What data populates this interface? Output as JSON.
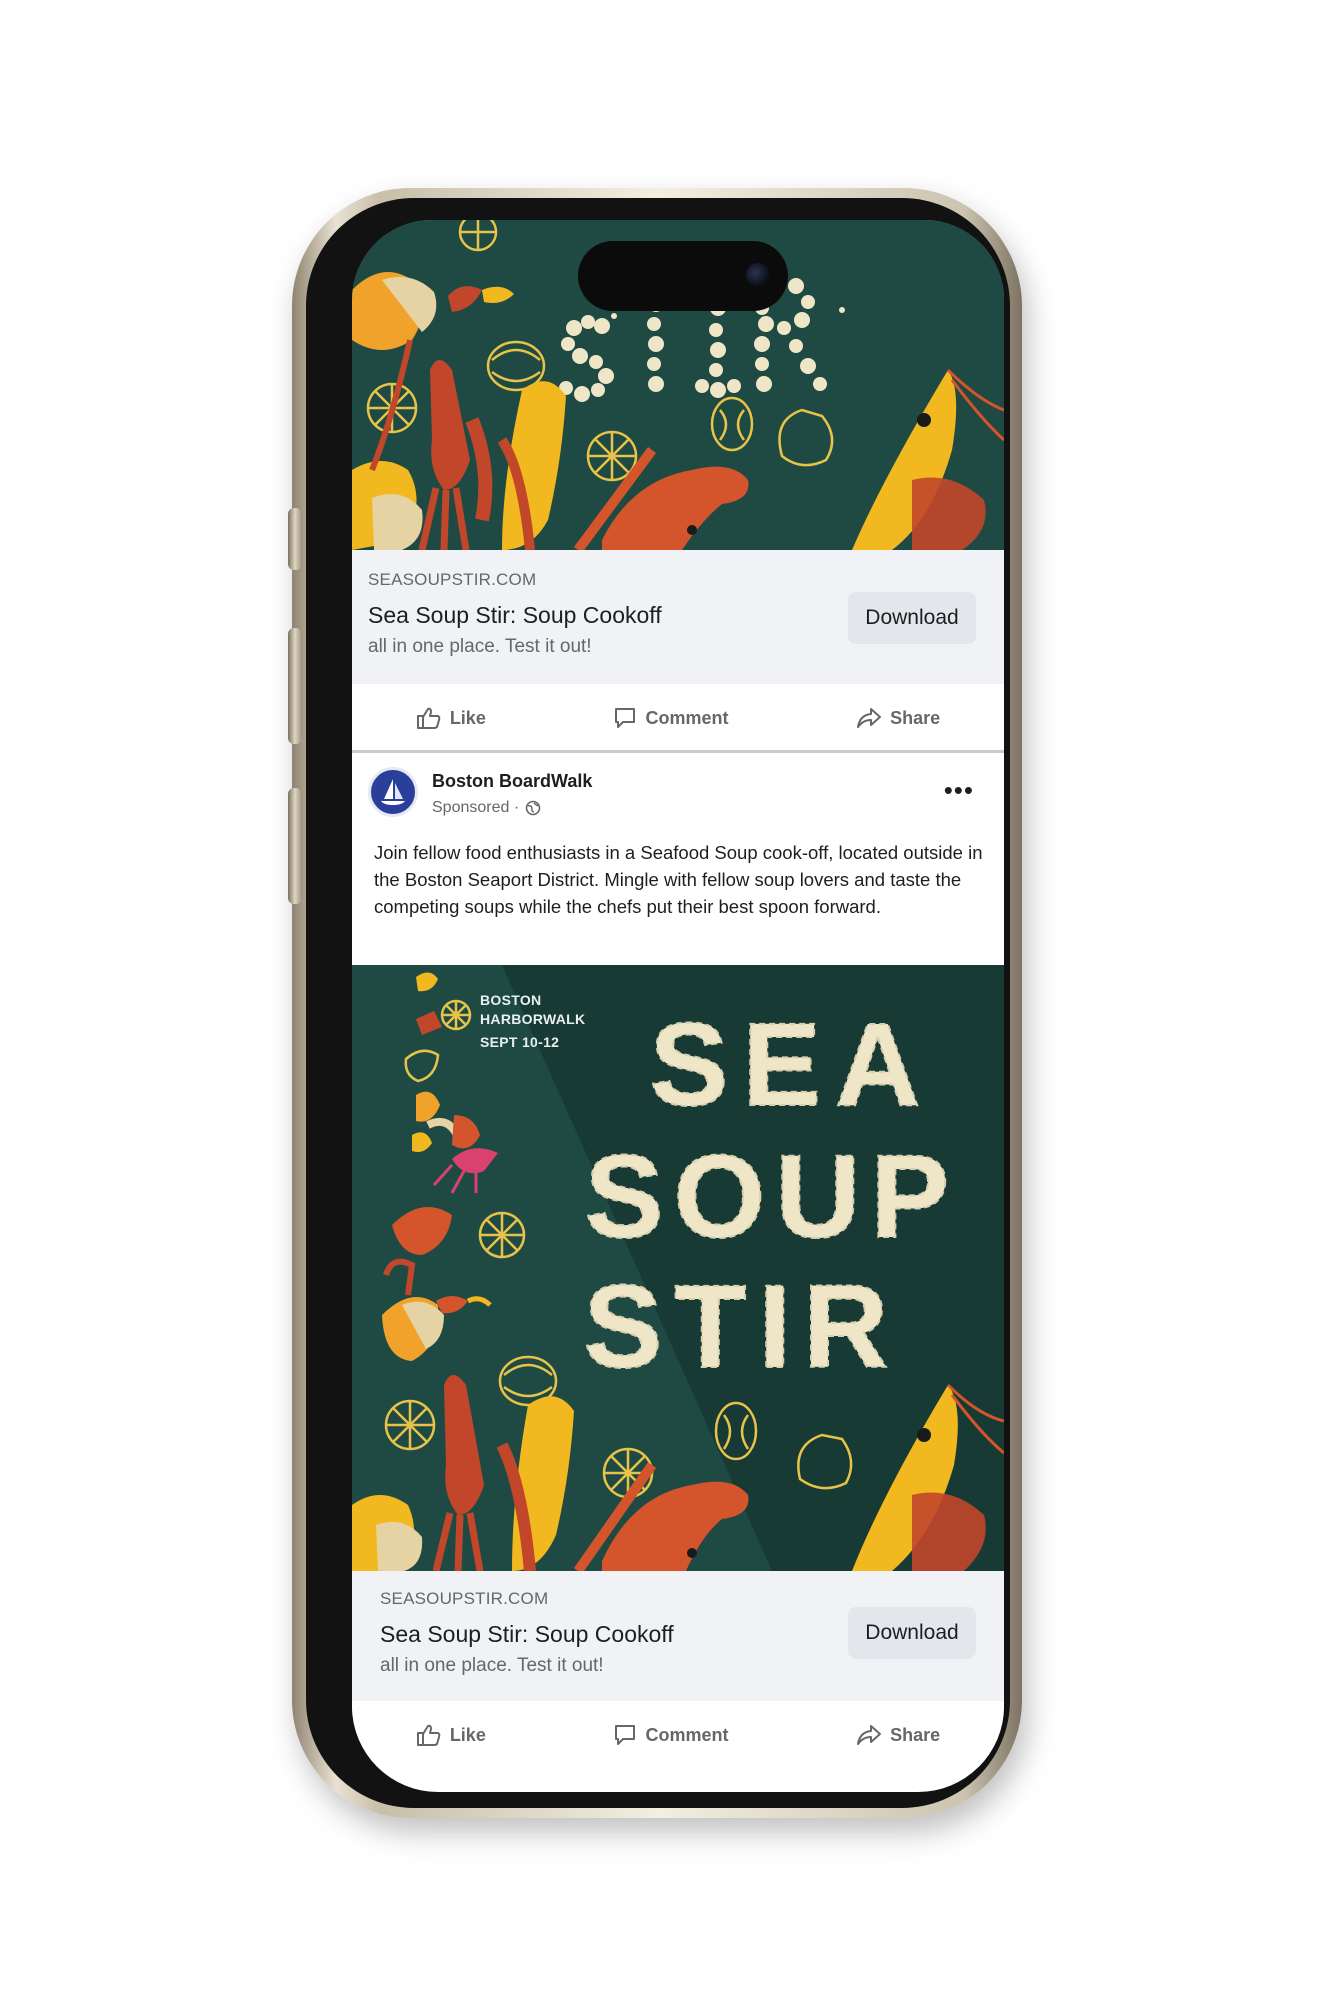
{
  "ads": [
    {
      "domain": "SEASOUPSTIR.COM",
      "title": "Sea Soup Stir: Soup Cookoff",
      "description": "all in one place. Test it out!",
      "cta_label": "Download"
    },
    {
      "domain": "SEASOUPSTIR.COM",
      "title": "Sea Soup Stir: Soup Cookoff",
      "description": "all in one place. Test it out!",
      "cta_label": "Download"
    }
  ],
  "actions": {
    "like": "Like",
    "comment": "Comment",
    "share": "Share"
  },
  "post": {
    "page_name": "Boston BoardWalk",
    "sponsored": "Sponsored ·",
    "more": "•••",
    "text": "Join fellow food enthusiasts in a Seafood Soup cook-off, located outside in the Boston Seaport District. Mingle with fellow soup lovers and taste the competing soups while the chefs put their best spoon forward."
  },
  "poster": {
    "location_line1": "BOSTON",
    "location_line2": "HARBORWALK",
    "dates": "SEPT 10-12",
    "title_line1": "SEA",
    "title_line2": "SOUP",
    "title_line3": "STIR"
  },
  "colors": {
    "poster_bg": "#1f4a44",
    "poster_bg_dark": "#173a35",
    "crayfish_orange": "#d4542b",
    "squid_red": "#c2472a",
    "shrimp_yellow": "#f2b81f",
    "oyster_orange": "#f0a22a",
    "line_gold": "#e8c34a",
    "noodle_cream": "#efe6c8"
  },
  "icons": [
    "like-icon",
    "comment-icon",
    "share-icon",
    "globe-icon",
    "more-icon"
  ]
}
